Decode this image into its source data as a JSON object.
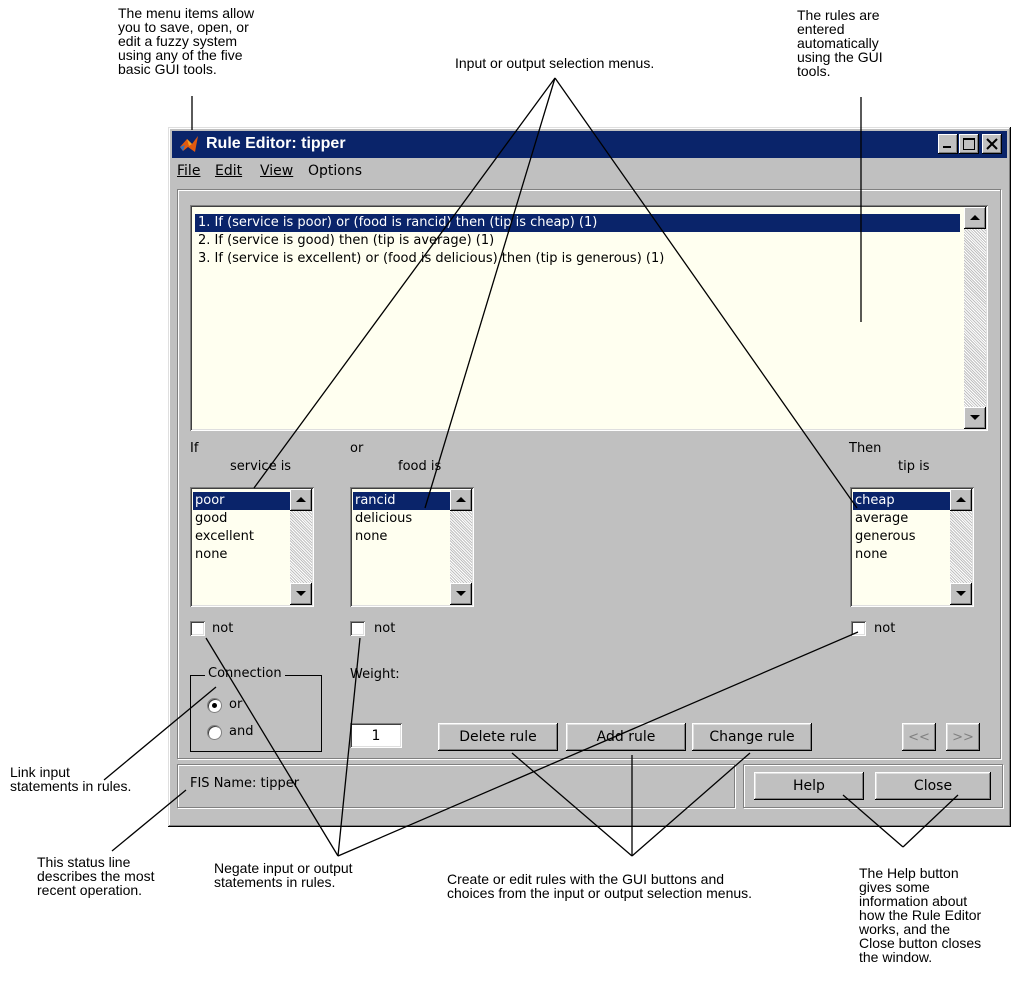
{
  "annotations": {
    "menu_items": "The menu items allow\nyou to save, open, or\nedit a fuzzy system\nusing any of the five\nbasic GUI tools.",
    "selection_menus": "Input or output selection menus.",
    "rules_entered": "The rules are\nentered\nautomatically\nusing the GUI\ntools.",
    "link_input": "Link input\nstatements in rules.",
    "status_line": "This status line\ndescribes the most\nrecent operation.",
    "negate": "Negate input or output\nstatements in rules.",
    "create_edit": "Create or edit rules with the GUI buttons and\nchoices from the input or output selection menus.",
    "help_button": "The Help button\ngives some\ninformation about\nhow the Rule Editor\nworks, and the\nClose button closes\nthe window."
  },
  "window": {
    "title": "Rule Editor: tipper",
    "menus": [
      "File",
      "Edit",
      "View",
      "Options"
    ]
  },
  "rules": [
    "1. If (service is poor) or (food is rancid) then (tip is cheap) (1)",
    "2. If (service is good) then (tip is average) (1)",
    "3. If (service is excellent) or (food is delicious) then (tip is generous) (1)"
  ],
  "inputs": {
    "if_label": "If",
    "service_label": "service is",
    "service_options": [
      "poor",
      "good",
      "excellent",
      "none"
    ],
    "or_label": "or",
    "food_label": "food is",
    "food_options": [
      "rancid",
      "delicious",
      "none"
    ],
    "then_label": "Then",
    "tip_label": "tip is",
    "tip_options": [
      "cheap",
      "average",
      "generous",
      "none"
    ],
    "not_label": "not"
  },
  "connection": {
    "title": "Connection",
    "options": [
      "or",
      "and"
    ],
    "selected": "or"
  },
  "weight": {
    "label": "Weight:",
    "value": "1"
  },
  "buttons": {
    "delete": "Delete rule",
    "add": "Add rule",
    "change": "Change rule",
    "prev": "<<",
    "next": ">>",
    "help": "Help",
    "close": "Close"
  },
  "status": "FIS Name: tipper",
  "colors": {
    "titlebar": "#0a246a",
    "window": "#c0c0c0",
    "list_bg": "#fffff0",
    "selection": "#0a246a"
  }
}
